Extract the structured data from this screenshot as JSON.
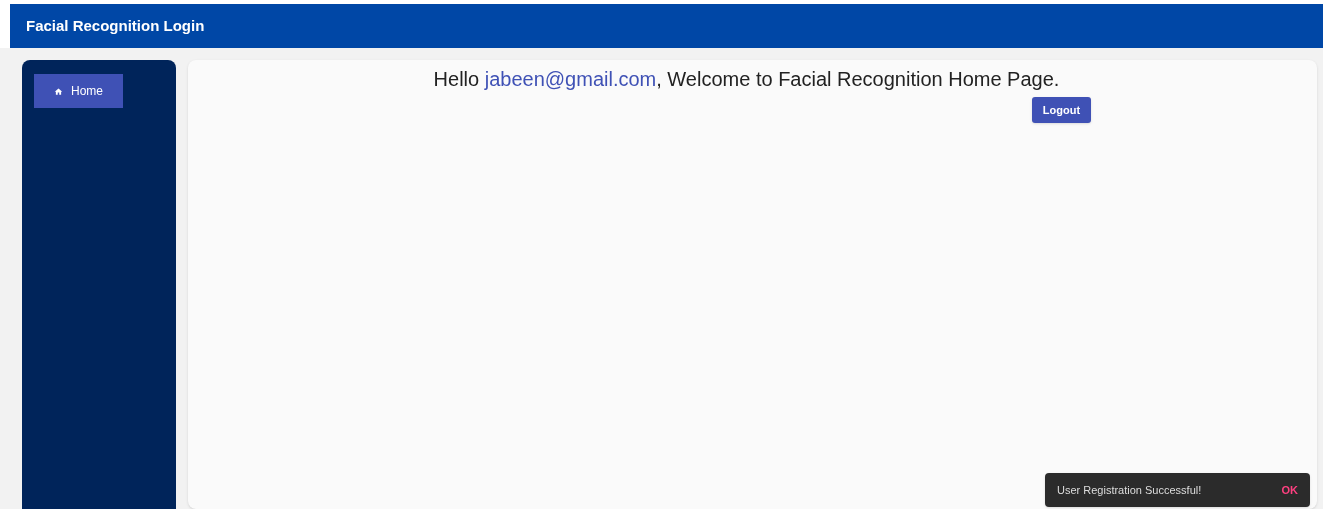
{
  "app_bar": {
    "title": "Facial Recognition Login"
  },
  "sidebar": {
    "items": [
      {
        "label": "Home",
        "selected": true
      }
    ]
  },
  "greeting": {
    "before": "Hello",
    "email": "jabeen@gmail.com",
    "after": ", Welcome to Facial Recognition Home Page."
  },
  "logout_button": "Logout",
  "snackbar": {
    "message": "User Registration Successful!",
    "action": "OK"
  }
}
